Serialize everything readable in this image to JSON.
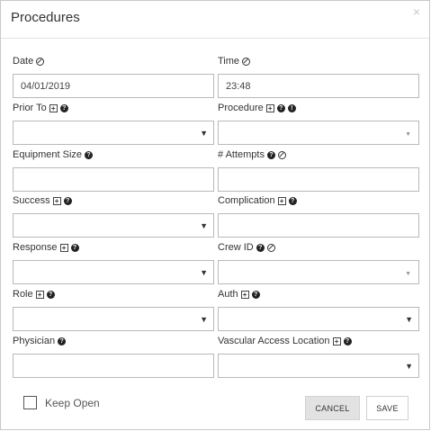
{
  "dialog": {
    "title": "Procedures",
    "close_glyph": "×"
  },
  "fields": {
    "date": {
      "label": "Date",
      "value": "04/01/2019"
    },
    "time": {
      "label": "Time",
      "value": "23:48"
    },
    "prior_to": {
      "label": "Prior To",
      "value": ""
    },
    "procedure": {
      "label": "Procedure",
      "value": ""
    },
    "equipment_size": {
      "label": "Equipment Size",
      "value": ""
    },
    "attempts": {
      "label": "# Attempts",
      "value": ""
    },
    "success": {
      "label": "Success",
      "value": ""
    },
    "complication": {
      "label": "Complication",
      "value": ""
    },
    "response": {
      "label": "Response",
      "value": ""
    },
    "crew_id": {
      "label": "Crew ID",
      "value": ""
    },
    "role": {
      "label": "Role",
      "value": ""
    },
    "auth": {
      "label": "Auth",
      "value": ""
    },
    "physician": {
      "label": "Physician",
      "value": ""
    },
    "vascular_access_location": {
      "label": "Vascular Access Location",
      "value": ""
    }
  },
  "footer": {
    "keep_open_label": "Keep Open",
    "keep_open_checked": false,
    "cancel_label": "CANCEL",
    "save_label": "SAVE"
  },
  "icons": {
    "help": "?",
    "plus": "+",
    "alert": "!",
    "caret_down": "▼",
    "caret_light": "▼"
  }
}
